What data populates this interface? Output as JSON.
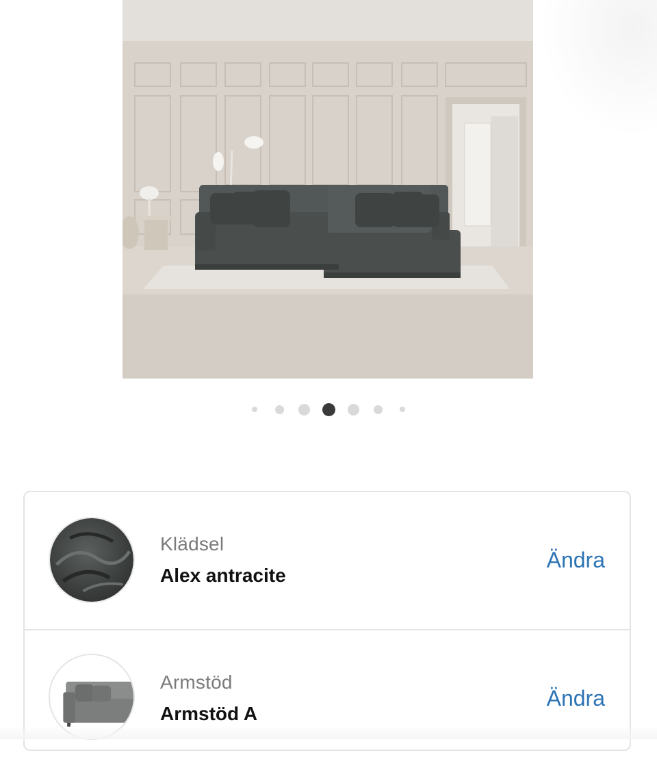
{
  "product_gallery": {
    "image_alt": "sofa-photo",
    "dots": [
      {
        "size": "s1",
        "active": false
      },
      {
        "size": "s2",
        "active": false
      },
      {
        "size": "s3",
        "active": false
      },
      {
        "size": "active",
        "active": true
      },
      {
        "size": "s3",
        "active": false
      },
      {
        "size": "s2",
        "active": false
      },
      {
        "size": "s1",
        "active": false
      }
    ],
    "active_index": 3
  },
  "options": [
    {
      "label": "Klädsel",
      "value": "Alex antracite",
      "action": "Ändra",
      "thumb_icon": "fabric-swatch-icon"
    },
    {
      "label": "Armstöd",
      "value": "Armstöd A",
      "action": "Ändra",
      "thumb_icon": "armrest-sofa-icon"
    }
  ],
  "colors": {
    "link": "#2d74b4",
    "active_dot": "#3a3a3a",
    "inactive_dot": "#d9d9d9",
    "sofa": "#4a4f4e"
  }
}
